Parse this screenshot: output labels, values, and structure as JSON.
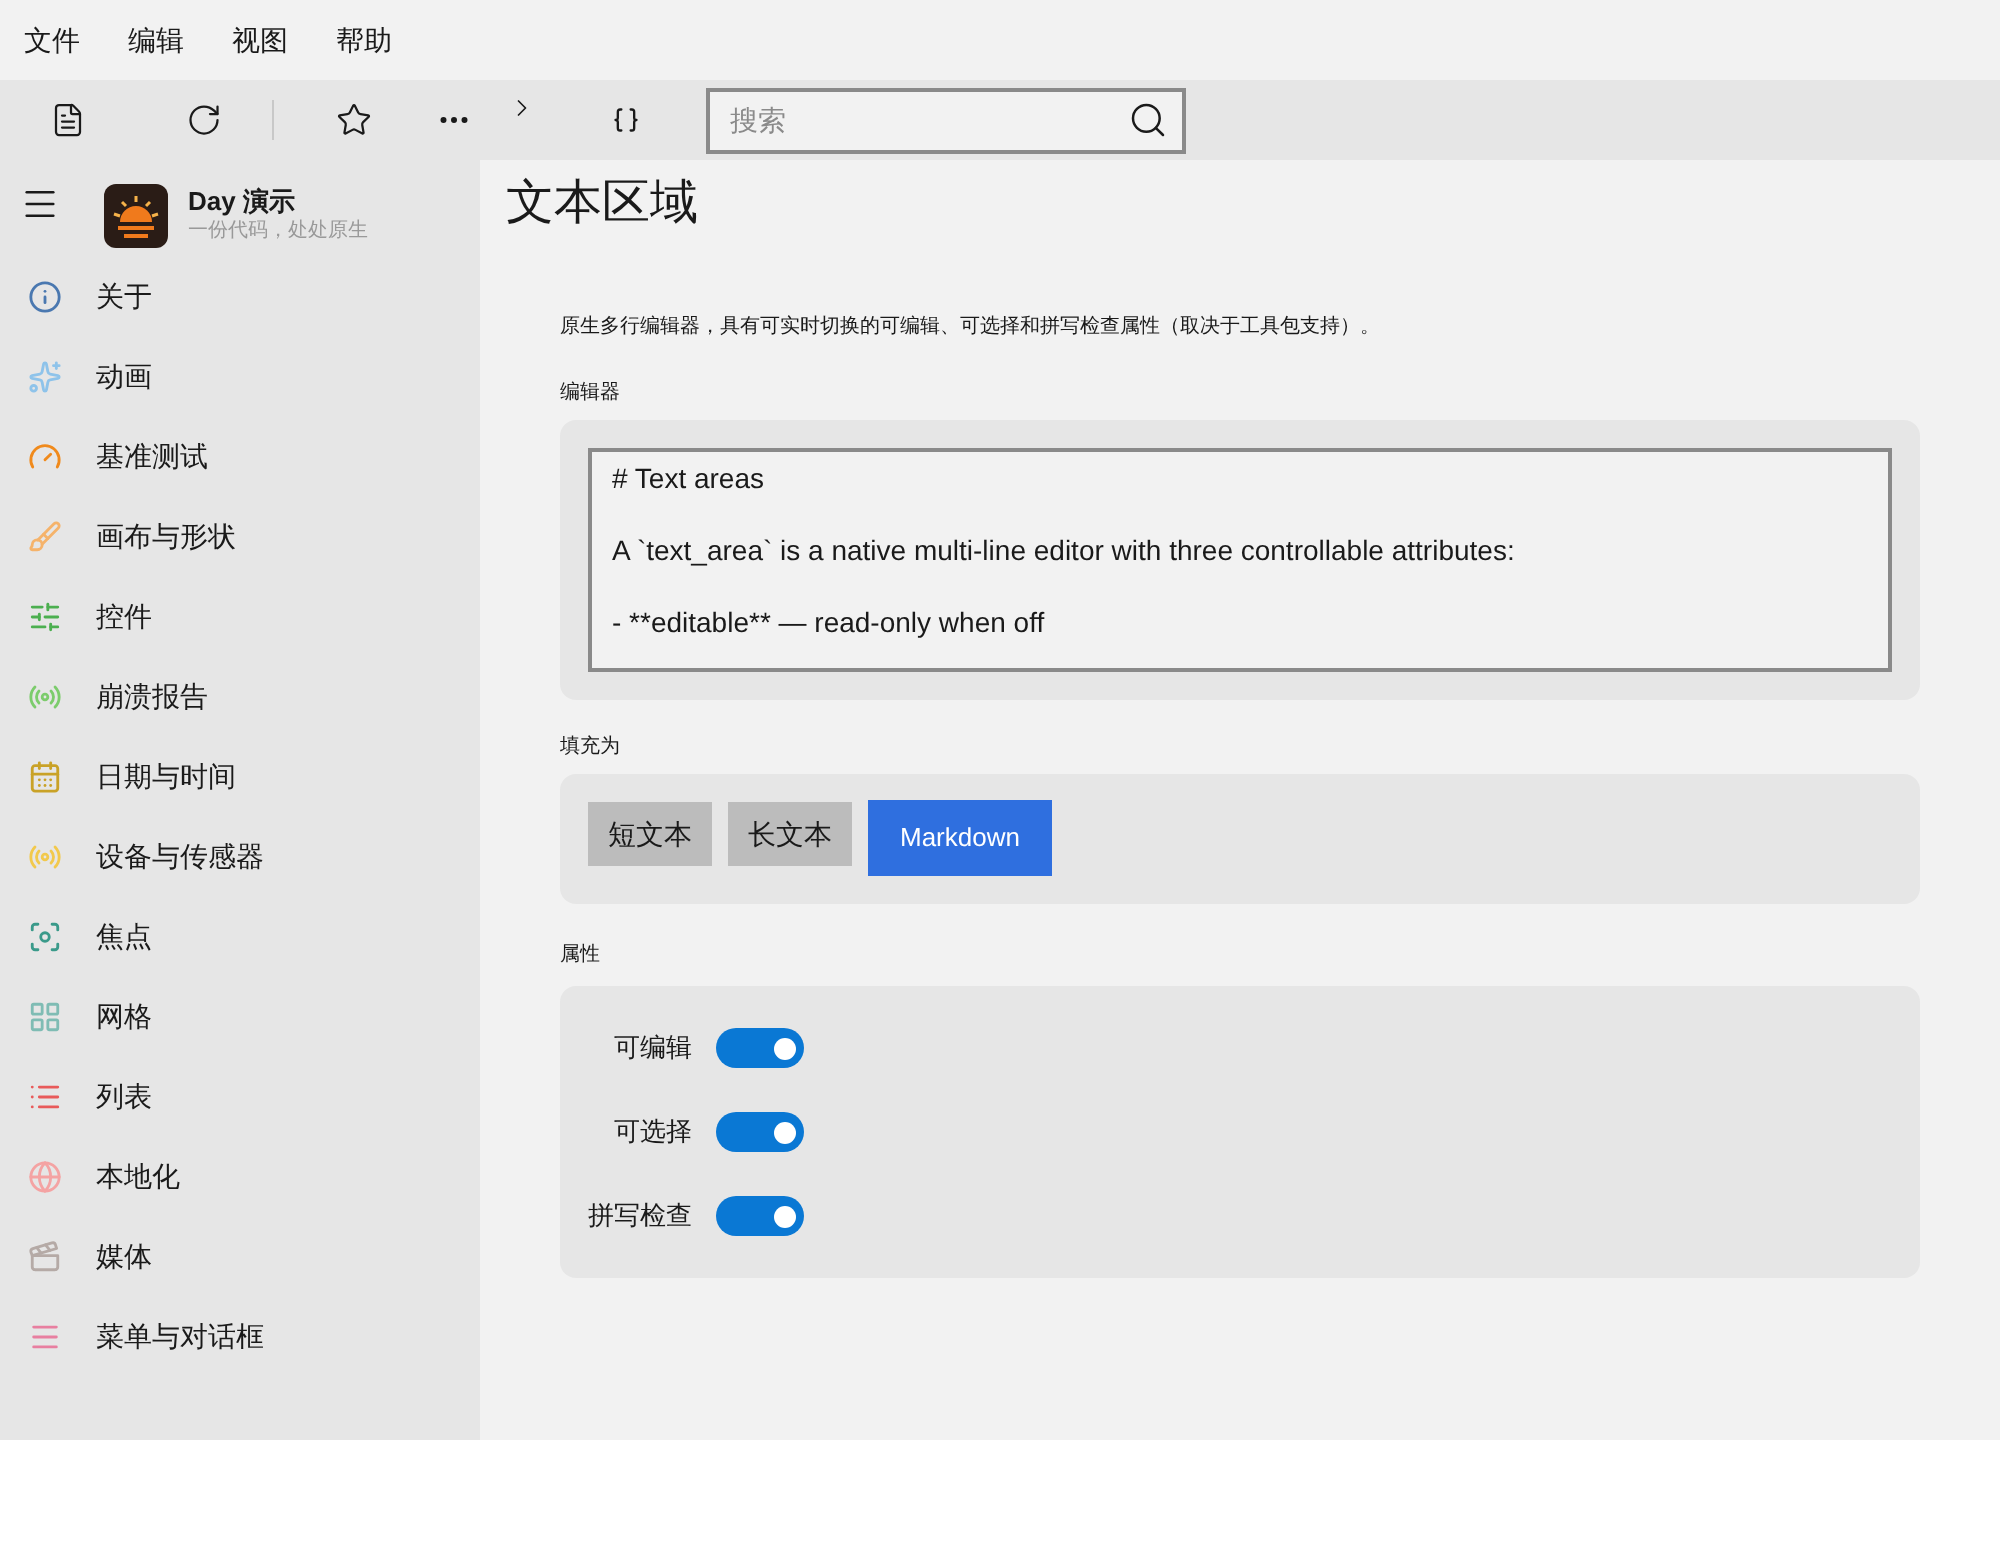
{
  "menu_bar": [
    "文件",
    "编辑",
    "视图",
    "帮助"
  ],
  "toolbar": {
    "search": {
      "placeholder": "搜索"
    }
  },
  "app": {
    "name": "Day 演示",
    "subtitle": "一份代码，处处原生"
  },
  "sidebar": {
    "items": [
      {
        "label": "关于",
        "color": "#4a78b0"
      },
      {
        "label": "动画",
        "color": "#8ec3ea"
      },
      {
        "label": "基准测试",
        "color": "#f08a1c"
      },
      {
        "label": "画布与形状",
        "color": "#f5b36b"
      },
      {
        "label": "控件",
        "color": "#4caf50"
      },
      {
        "label": "崩溃报告",
        "color": "#7ccc6c"
      },
      {
        "label": "日期与时间",
        "color": "#c9a227"
      },
      {
        "label": "设备与传感器",
        "color": "#f2c94c"
      },
      {
        "label": "焦点",
        "color": "#3a9a8a"
      },
      {
        "label": "网格",
        "color": "#7fbcb4"
      },
      {
        "label": "列表",
        "color": "#e85a5a"
      },
      {
        "label": "本地化",
        "color": "#f4a3a3"
      },
      {
        "label": "媒体",
        "color": "#b5aaa6"
      },
      {
        "label": "菜单与对话框",
        "color": "#e87fa0"
      }
    ]
  },
  "page": {
    "title": "文本区域",
    "description": "原生多行编辑器，具有可实时切换的可编辑、可选择和拼写检查属性（取决于工具包支持）。",
    "editor": {
      "label": "编辑器",
      "value": "# Text areas\n\nA `text_area` is a native multi-line editor with three controllable attributes:\n\n- **editable** — read-only when off"
    },
    "fill": {
      "label": "填充为",
      "buttons": [
        {
          "label": "短文本",
          "selected": false
        },
        {
          "label": "长文本",
          "selected": false
        },
        {
          "label": "Markdown",
          "selected": true
        }
      ]
    },
    "properties": {
      "label": "属性",
      "toggles": [
        {
          "label": "可编辑",
          "on": true
        },
        {
          "label": "可选择",
          "on": true
        },
        {
          "label": "拼写检查",
          "on": true
        }
      ]
    }
  }
}
